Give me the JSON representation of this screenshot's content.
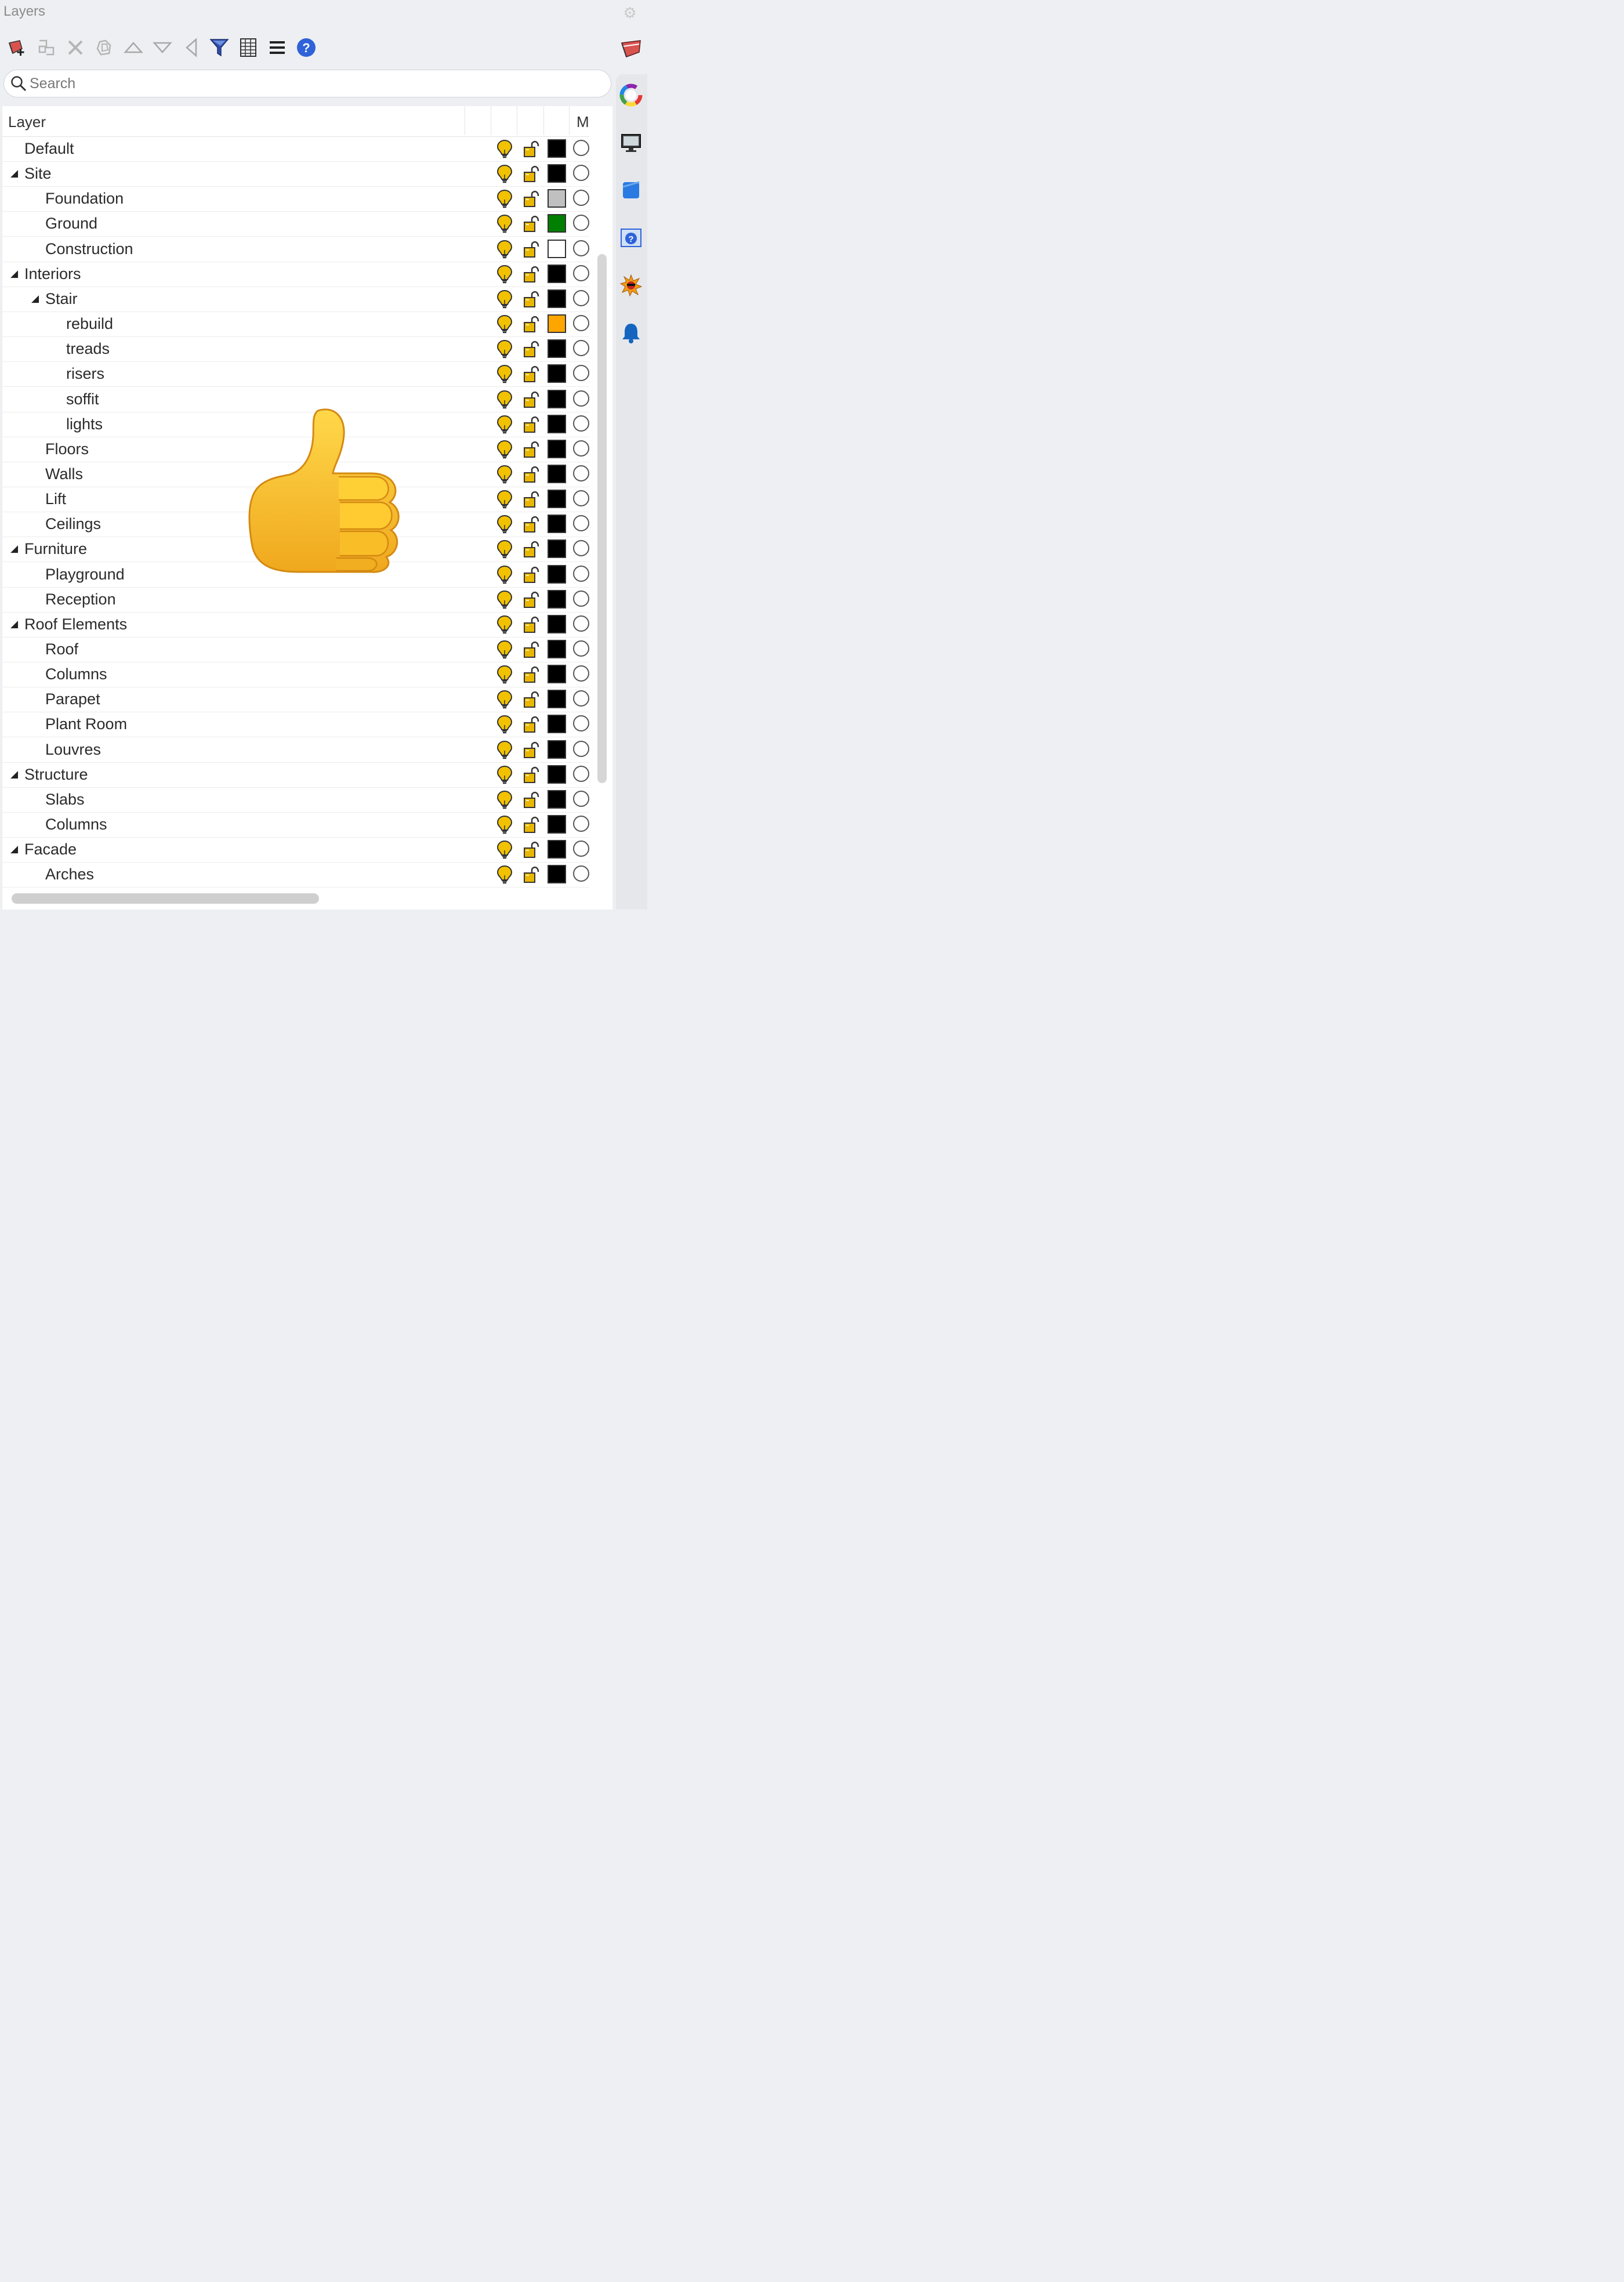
{
  "panel": {
    "title": "Layers"
  },
  "search": {
    "placeholder": "Search"
  },
  "columns": {
    "layer": "Layer",
    "material": "M"
  },
  "icons": {
    "settings": "gear-icon",
    "toolbar": [
      "new-layer-icon",
      "new-sublayer-icon",
      "delete-icon",
      "copy-icon",
      "move-up-icon",
      "move-down-icon",
      "move-left-icon",
      "filter-icon",
      "grid-icon",
      "menu-icon",
      "help-icon"
    ],
    "sidebar": [
      "layers-tab-icon",
      "color-wheel-icon",
      "display-icon",
      "blue-square-icon",
      "help-tab-icon",
      "sun-icon",
      "notification-bell-icon"
    ],
    "overlay": "thumbs-up-emoji"
  },
  "colors": {
    "bulb": "#f2c200",
    "lock": "#e9b700",
    "help": "#2f62d9",
    "filter": "#2e4da8"
  },
  "layers": [
    {
      "name": "Default",
      "depth": 0,
      "expandable": false,
      "color": "#000000"
    },
    {
      "name": "Site",
      "depth": 0,
      "expandable": true,
      "color": "#000000"
    },
    {
      "name": "Foundation",
      "depth": 1,
      "expandable": false,
      "color": "#c0c0c0"
    },
    {
      "name": "Ground",
      "depth": 1,
      "expandable": false,
      "color": "#007f00"
    },
    {
      "name": "Construction",
      "depth": 1,
      "expandable": false,
      "color": "#ffffff"
    },
    {
      "name": "Interiors",
      "depth": 0,
      "expandable": true,
      "color": "#000000"
    },
    {
      "name": "Stair",
      "depth": 1,
      "expandable": true,
      "color": "#000000"
    },
    {
      "name": "rebuild",
      "depth": 2,
      "expandable": false,
      "color": "#ffa500"
    },
    {
      "name": "treads",
      "depth": 2,
      "expandable": false,
      "color": "#000000"
    },
    {
      "name": "risers",
      "depth": 2,
      "expandable": false,
      "color": "#000000"
    },
    {
      "name": "soffit",
      "depth": 2,
      "expandable": false,
      "color": "#000000"
    },
    {
      "name": "lights",
      "depth": 2,
      "expandable": false,
      "color": "#000000"
    },
    {
      "name": "Floors",
      "depth": 1,
      "expandable": false,
      "color": "#000000"
    },
    {
      "name": "Walls",
      "depth": 1,
      "expandable": false,
      "color": "#000000"
    },
    {
      "name": "Lift",
      "depth": 1,
      "expandable": false,
      "color": "#000000"
    },
    {
      "name": "Ceilings",
      "depth": 1,
      "expandable": false,
      "color": "#000000"
    },
    {
      "name": "Furniture",
      "depth": 0,
      "expandable": true,
      "color": "#000000"
    },
    {
      "name": "Playground",
      "depth": 1,
      "expandable": false,
      "color": "#000000"
    },
    {
      "name": "Reception",
      "depth": 1,
      "expandable": false,
      "color": "#000000"
    },
    {
      "name": "Roof Elements",
      "depth": 0,
      "expandable": true,
      "color": "#000000"
    },
    {
      "name": "Roof",
      "depth": 1,
      "expandable": false,
      "color": "#000000"
    },
    {
      "name": "Columns",
      "depth": 1,
      "expandable": false,
      "color": "#000000"
    },
    {
      "name": "Parapet",
      "depth": 1,
      "expandable": false,
      "color": "#000000"
    },
    {
      "name": "Plant Room",
      "depth": 1,
      "expandable": false,
      "color": "#000000"
    },
    {
      "name": "Louvres",
      "depth": 1,
      "expandable": false,
      "color": "#000000"
    },
    {
      "name": "Structure",
      "depth": 0,
      "expandable": true,
      "color": "#000000"
    },
    {
      "name": "Slabs",
      "depth": 1,
      "expandable": false,
      "color": "#000000"
    },
    {
      "name": "Columns",
      "depth": 1,
      "expandable": false,
      "color": "#000000"
    },
    {
      "name": "Facade",
      "depth": 0,
      "expandable": true,
      "color": "#000000"
    },
    {
      "name": "Arches",
      "depth": 1,
      "expandable": false,
      "color": "#000000"
    }
  ]
}
